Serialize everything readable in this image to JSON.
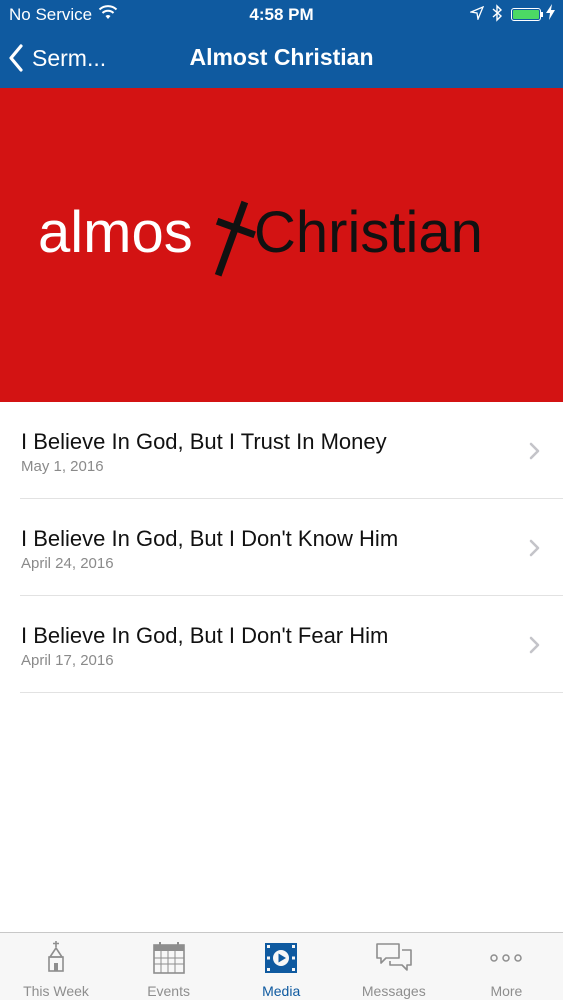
{
  "status_bar": {
    "carrier": "No Service",
    "time": "4:58 PM",
    "battery_level": 1.0
  },
  "nav": {
    "back_label": "Serm...",
    "title": "Almost Christian"
  },
  "banner": {
    "text_left": "almos",
    "text_right": "Christian",
    "background_color": "#d31313"
  },
  "sermons": [
    {
      "title": "I Believe In God, But I Trust In Money",
      "date": "May 1, 2016"
    },
    {
      "title": "I Believe In God, But I Don't Know Him",
      "date": "April 24, 2016"
    },
    {
      "title": "I Believe In God, But I Don't Fear Him",
      "date": "April 17, 2016"
    }
  ],
  "tabs": [
    {
      "label": "This Week",
      "icon": "church-icon",
      "active": false
    },
    {
      "label": "Events",
      "icon": "calendar-icon",
      "active": false
    },
    {
      "label": "Media",
      "icon": "media-film-icon",
      "active": true
    },
    {
      "label": "Messages",
      "icon": "chat-bubbles-icon",
      "active": false
    },
    {
      "label": "More",
      "icon": "more-dots-icon",
      "active": false
    }
  ],
  "colors": {
    "accent": "#0f5aa0",
    "banner_red": "#d31313",
    "inactive_tab": "#8e8e8e"
  }
}
